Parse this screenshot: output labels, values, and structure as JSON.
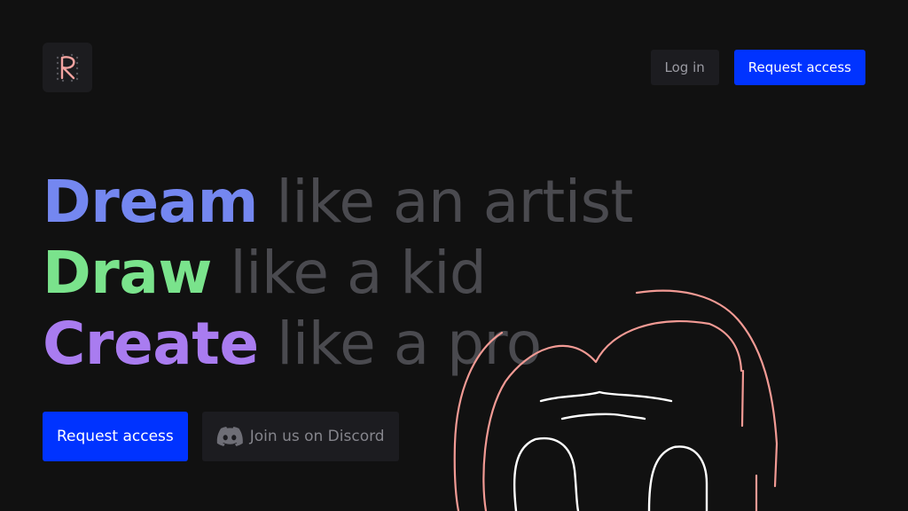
{
  "logo": {
    "letter": "R"
  },
  "nav": {
    "login_label": "Log in",
    "request_label": "Request access"
  },
  "headline": {
    "lines": [
      {
        "strong": "Dream",
        "rest": "like an artist",
        "color": "#7487f0"
      },
      {
        "strong": "Draw",
        "rest": "like a kid",
        "color": "#7ae38c"
      },
      {
        "strong": "Create",
        "rest": "like a pro",
        "color": "#a97cf0"
      }
    ]
  },
  "cta": {
    "request_label": "Request access",
    "discord_label": "Join us on Discord"
  },
  "colors": {
    "accent_blue": "#0033ff",
    "background": "#111111",
    "doodle_pink": "#f29a94"
  },
  "icons": {
    "logo": "r-logo-icon",
    "discord": "discord-icon"
  }
}
